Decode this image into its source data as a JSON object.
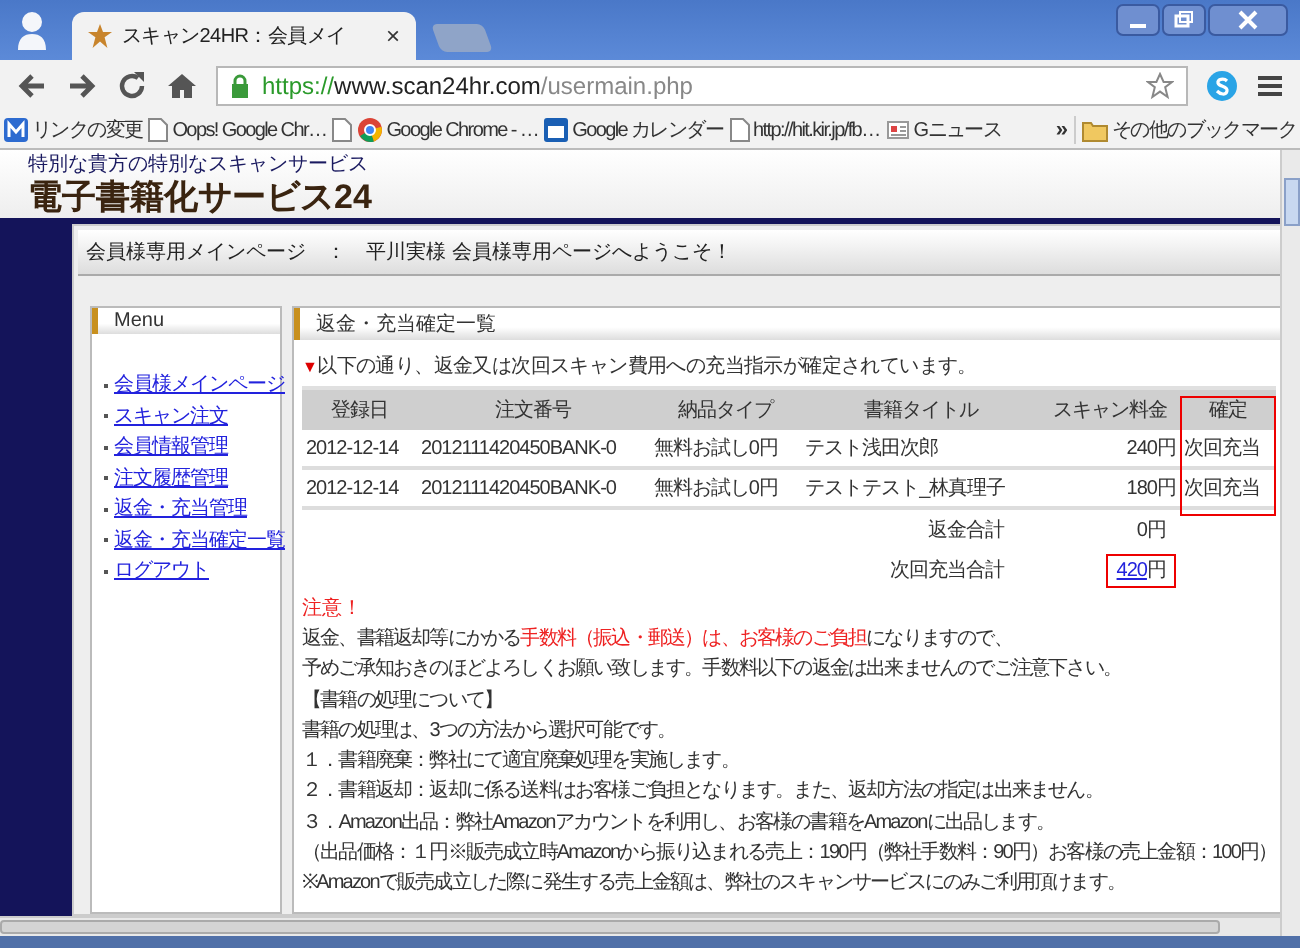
{
  "browser": {
    "tab_title": "スキャン24HR：会員メイ",
    "tab_close": "×",
    "url_scheme": "https://",
    "url_host": "www.scan24hr.com",
    "url_path": "/usermain.php",
    "bookmarks": [
      {
        "kind": "app",
        "label": "リンクの変更"
      },
      {
        "kind": "page",
        "label": "Oops! Google Chr…"
      },
      {
        "kind": "page"
      },
      {
        "kind": "chrome",
        "label": "Google Chrome - …"
      },
      {
        "kind": "calendar",
        "label": "Google カレンダー"
      },
      {
        "kind": "page",
        "label": "http://hit.kir.jp/fb…"
      },
      {
        "kind": "news",
        "label": "Gニュース"
      }
    ],
    "bookmarks_overflow": "»",
    "other_bookmarks": "その他のブックマーク"
  },
  "site": {
    "tagline": "特別な貴方の特別なスキャンサービス",
    "logo": "電子書籍化サービス24",
    "breadcrumb": "会員様専用メインページ　：　平川実様 会員様専用ページへようこそ！",
    "menu": {
      "title": "Menu",
      "items": [
        "会員様メインページ",
        "スキャン注文",
        "会員情報管理",
        "注文履歴管理",
        "返金・充当管理",
        "返金・充当確定一覧",
        "ログアウト"
      ]
    },
    "section_title": "返金・充当確定一覧",
    "notice_marker": "▼",
    "notice": "以下の通り、返金又は次回スキャン費用への充当指示が確定されています。",
    "table": {
      "columns": [
        "登録日",
        "注文番号",
        "納品タイプ",
        "書籍タイトル",
        "スキャン料金",
        "確定"
      ],
      "rows": [
        [
          "2012-12-14",
          "2012111420450BANK-0",
          "無料お試し0円",
          "テスト浅田次郎",
          "240円",
          "次回充当"
        ],
        [
          "2012-12-14",
          "2012111420450BANK-0",
          "無料お試し0円",
          "テストテスト_林真理子",
          "180円",
          "次回充当"
        ]
      ],
      "highlight_last_column": true
    },
    "totals": [
      {
        "label": "返金合計",
        "amount": "0円",
        "highlighted": false
      },
      {
        "label": "次回充当合計",
        "amount_link": "420",
        "amount": "円",
        "highlighted": true
      }
    ],
    "caution_title": "注意！",
    "caution_lines": [
      [
        {
          "text": "返金、書籍返却等にかかる",
          "red": false
        },
        {
          "text": "手数料（振込・郵送）は、お客様のご負担",
          "red": true
        },
        {
          "text": "になりますので、",
          "red": false
        }
      ],
      [
        {
          "text": "予めご承知おきのほどよろしくお願い致します。手数料以下の返金は出来ませんのでご注意下さい。",
          "red": false
        }
      ],
      [
        {
          "text": "【書籍の処理について】",
          "red": false
        }
      ],
      [
        {
          "text": "書籍の処理は、3つの方法から選択可能です。",
          "red": false
        }
      ],
      [
        {
          "text": "１．書籍廃棄：弊社にて適宜廃棄処理を実施します。",
          "red": false
        }
      ],
      [
        {
          "text": "２．書籍返却：返却に係る送料はお客様ご負担となります。また、返却方法の指定は出来ません。",
          "red": false
        }
      ],
      [
        {
          "text": "３．Amazon出品：弊社Amazonアカウントを利用し、お客様の書籍をAmazonに出品します。",
          "red": false
        }
      ],
      [
        {
          "text": "（出品価格：１円※販売成立時Amazonから振り込まれる売上：190円（弊社手数料：90円）お客様の売上金額：100円）",
          "red": false
        }
      ],
      [
        {
          "text": "※Amazonで販売成立した際に発生する売上金額は、弊社のスキャンサービスにのみご利用頂けます。",
          "red": false
        }
      ]
    ]
  }
}
